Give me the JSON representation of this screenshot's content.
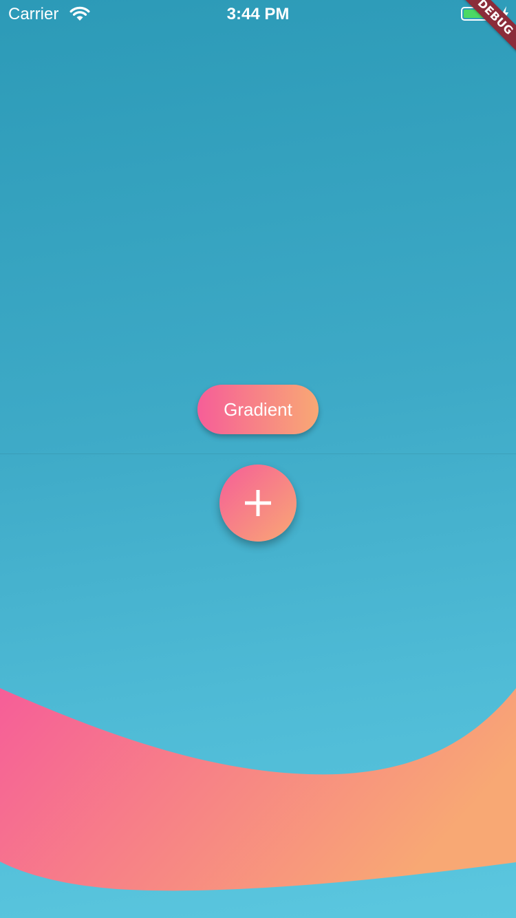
{
  "status_bar": {
    "carrier": "Carrier",
    "time": "3:44 PM",
    "icons": [
      "wifi-icon",
      "battery-icon",
      "charging-bolt-icon"
    ]
  },
  "debug_banner": {
    "label": "DEBUG"
  },
  "main": {
    "gradient_button_label": "Gradient",
    "fab_icon": "plus-icon"
  },
  "colors": {
    "background_top": "#2c9ab7",
    "background_bottom": "#5bc7df",
    "gradient_start": "#f65e98",
    "gradient_end": "#f8a874",
    "debug_banner": "#8b2c3a",
    "battery_fill": "#4cd964"
  }
}
